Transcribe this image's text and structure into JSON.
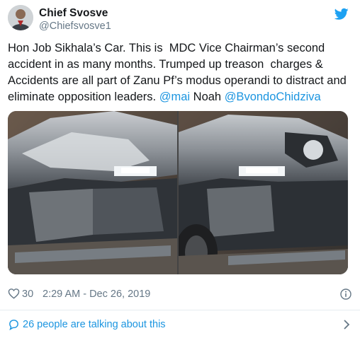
{
  "tweet": {
    "display_name": "Chief Svosve",
    "handle": "@Chiefsvosve1",
    "text_part1": "Hon Job Sikhala’s Car. This is  MDC Vice Chairman’s second accident in as many months. Trumped up treason  charges & Accidents are all part of Zanu Pf’s modus operandi to distract and eliminate opposition leaders. ",
    "mention_1": "@mai",
    "text_part2": " Noah ",
    "mention_2": "@BvondoChidziva",
    "likes": "30",
    "timestamp": "2:29 AM - Dec 26, 2019",
    "talking": "26 people are talking about this"
  },
  "icons": {
    "brand": "twitter-bird-icon",
    "like": "heart-icon",
    "info": "info-icon",
    "reply": "speech-bubble-icon",
    "more": "chevron-right-icon"
  },
  "colors": {
    "link": "#1b95e0",
    "muted": "#657786",
    "text": "#14171a",
    "brand": "#1da1f2"
  }
}
